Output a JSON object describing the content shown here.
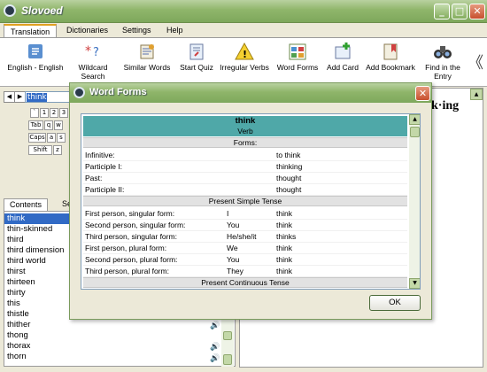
{
  "window": {
    "title": "Slovoed",
    "min": "_",
    "max": "□",
    "close": "✕"
  },
  "tabs": [
    "Translation",
    "Dictionaries",
    "Settings",
    "Help"
  ],
  "toolbar": {
    "items": [
      {
        "label": "English - English",
        "icon": "book-icon"
      },
      {
        "label": "Wildcard Search",
        "icon": "wildcard-icon"
      },
      {
        "label": "Similar Words",
        "icon": "similar-words-icon"
      },
      {
        "label": "Start Quiz",
        "icon": "quiz-icon"
      },
      {
        "label": "Irregular Verbs",
        "icon": "irregular-verbs-icon"
      },
      {
        "label": "Word Forms",
        "icon": "word-forms-icon"
      },
      {
        "label": "Add Card",
        "icon": "add-card-icon"
      },
      {
        "label": "Add Bookmark",
        "icon": "bookmark-icon"
      },
      {
        "label": "Find in the Entry",
        "icon": "binoculars-icon"
      }
    ],
    "more": "《"
  },
  "search": {
    "value": "think"
  },
  "nav": {
    "back": "◀",
    "forward": "▶"
  },
  "keyboard": {
    "keys": [
      "`",
      "1",
      "2",
      "3",
      "Tab",
      "q",
      "w",
      "Caps",
      "a",
      "s",
      "Shift",
      "z"
    ]
  },
  "left_tabs": [
    "Contents",
    "Se"
  ],
  "words": [
    "think",
    "thin-skinned",
    "third",
    "third dimension",
    "third world",
    "thirst",
    "thirteen",
    "thirty",
    "this",
    "thistle",
    "thither",
    "thong",
    "thorax",
    "thorn"
  ],
  "speaker": "🔊",
  "right_word": "k·ing",
  "dialog": {
    "title": "Word Forms",
    "close": "✕",
    "word": "think",
    "pos": "Verb",
    "sections": [
      {
        "title": "Forms:",
        "rows": [
          {
            "label": "Infinitive:",
            "pron": "",
            "value": "to think"
          },
          {
            "label": "Participle I:",
            "pron": "",
            "value": "thinking"
          },
          {
            "label": "Past:",
            "pron": "",
            "value": "thought"
          },
          {
            "label": "Participle II:",
            "pron": "",
            "value": "thought"
          }
        ]
      },
      {
        "title": "Present Simple Tense",
        "rows": [
          {
            "label": "First person, singular form:",
            "pron": "I",
            "value": "think"
          },
          {
            "label": "Second person, singular form:",
            "pron": "You",
            "value": "think"
          },
          {
            "label": "Third person, singular form:",
            "pron": "He/she/it",
            "value": "thinks"
          },
          {
            "label": "First person, plural form:",
            "pron": "We",
            "value": "think"
          },
          {
            "label": "Second person, plural form:",
            "pron": "You",
            "value": "think"
          },
          {
            "label": "Third person, plural form:",
            "pron": "They",
            "value": "think"
          }
        ]
      },
      {
        "title": "Present Continuous Tense",
        "rows": []
      }
    ],
    "ok": "OK"
  }
}
